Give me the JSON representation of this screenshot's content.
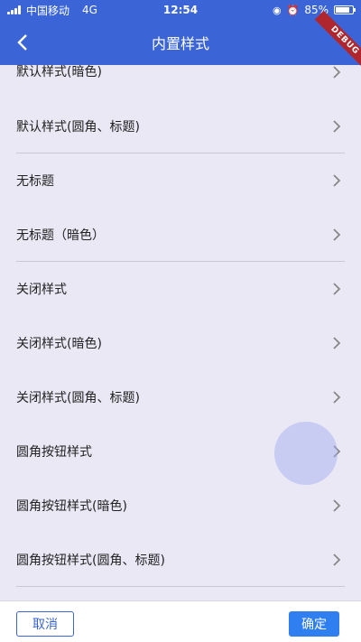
{
  "status_bar": {
    "carrier": "中国移动",
    "network": "4G",
    "time": "12:54",
    "battery_percent": "85%",
    "battery_level": 0.85
  },
  "app_bar": {
    "title": "内置样式",
    "debug_label": "DEBUG"
  },
  "list": {
    "items": [
      {
        "label": "默认样式(暗色)"
      },
      {
        "label": "默认样式(圆角、标题)"
      },
      {
        "label": "无标题"
      },
      {
        "label": "无标题（暗色）"
      },
      {
        "label": "关闭样式"
      },
      {
        "label": "关闭样式(暗色)"
      },
      {
        "label": "关闭样式(圆角、标题)"
      },
      {
        "label": "圆角按钮样式"
      },
      {
        "label": "圆角按钮样式(暗色)"
      },
      {
        "label": "圆角按钮样式(圆角、标题)"
      }
    ]
  },
  "bottom_bar": {
    "cancel_label": "取消",
    "confirm_label": "确定"
  },
  "colors": {
    "primary": "#3b65d6",
    "confirm": "#2f7ff0",
    "background": "#e9e8f4"
  }
}
